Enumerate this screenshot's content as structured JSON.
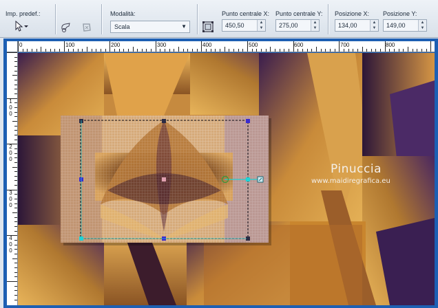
{
  "toolbar": {
    "preset_label": "Imp. predef.:",
    "mode_label": "Modalità:",
    "mode_value": "Scala",
    "center_x_label": "Punto centrale X:",
    "center_x_value": "450,50",
    "center_y_label": "Punto centrale Y:",
    "center_y_value": "275,00",
    "pos_x_label": "Posizione X:",
    "pos_x_value": "134,00",
    "pos_y_label": "Posizione Y:",
    "pos_y_value": "149,00"
  },
  "ruler": {
    "h_labels": [
      "0",
      "100",
      "200",
      "300",
      "400",
      "500",
      "600",
      "700",
      "800"
    ],
    "v_labels": [
      "1",
      "0",
      "0",
      "2",
      "0",
      "0",
      "3",
      "0",
      "0",
      "4",
      "0",
      "0"
    ]
  },
  "watermark": {
    "name": "Pinuccia",
    "url": "www.maidiregrafica.eu"
  },
  "icons": [
    "arrow-cursor-icon",
    "chevron-down-icon",
    "preset-edit-icon",
    "preset-reset-icon",
    "transform-icon"
  ]
}
